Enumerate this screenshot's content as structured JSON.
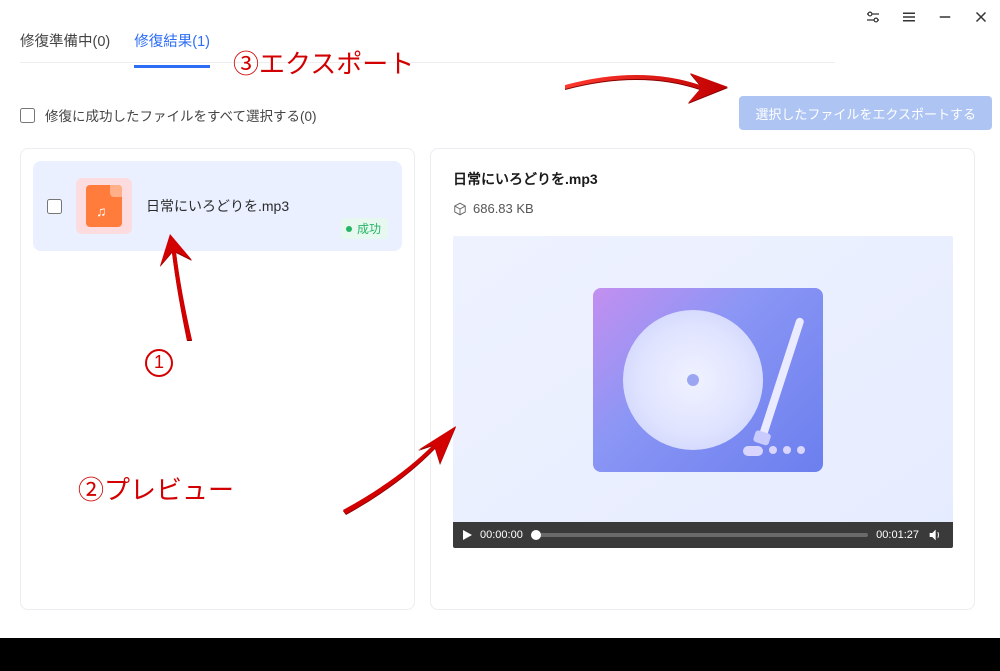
{
  "titlebar": {
    "settings_icon": "settings",
    "menu_icon": "menu",
    "minimize_icon": "minimize",
    "close_icon": "close"
  },
  "tabs": {
    "preparing": "修復準備中(0)",
    "results": "修復結果(1)"
  },
  "select_all": {
    "label": "修復に成功したファイルをすべて選択する(0)"
  },
  "export_button": {
    "label": "選択したファイルをエクスポートする"
  },
  "file_item": {
    "name": "日常にいろどりを.mp3",
    "status": "成功"
  },
  "preview": {
    "title": "日常にいろどりを.mp3",
    "size": "686.83 KB"
  },
  "player": {
    "current": "00:00:00",
    "total": "00:01:27"
  },
  "annotations": {
    "step1": "①",
    "step2_label": "②プレビュー",
    "step3_label": "③エクスポート"
  }
}
